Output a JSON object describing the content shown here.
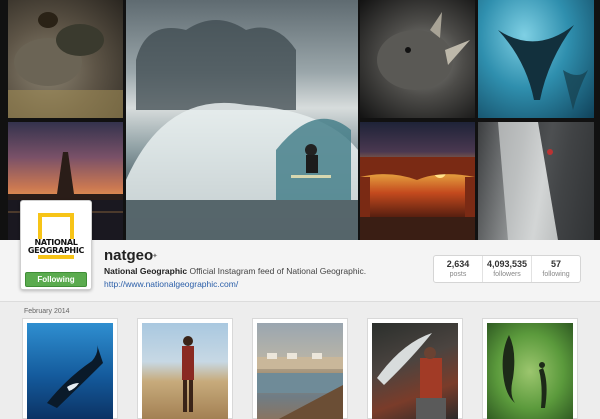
{
  "profile": {
    "username": "natgeo",
    "verified_icon": "verified-badge-icon",
    "display_name": "National Geographic",
    "bio": "Official Instagram feed of National Geographic.",
    "website": "http://www.nationalgeographic.com/",
    "avatar_text": "NATIONAL\nGEOGRAPHIC",
    "follow_button": "Following"
  },
  "stats": [
    {
      "value": "2,634",
      "label": "posts"
    },
    {
      "value": "4,093,535",
      "label": "followers"
    },
    {
      "value": "57",
      "label": "following"
    }
  ],
  "feed": {
    "month_label": "February 2014"
  },
  "colors": {
    "follow_green": "#5aab4e",
    "link_blue": "#2a5ea8",
    "natgeo_yellow": "#f7c417"
  }
}
